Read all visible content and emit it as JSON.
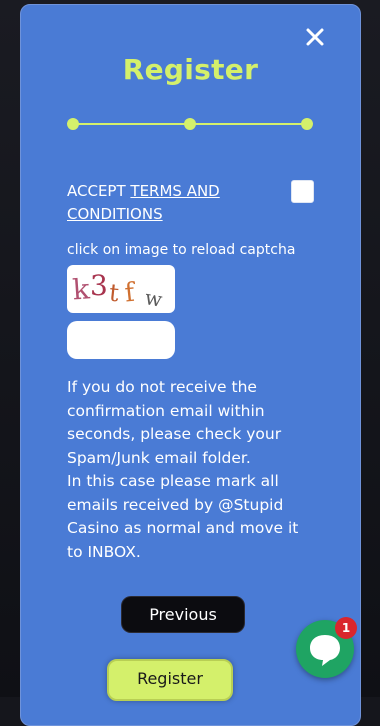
{
  "modal": {
    "title": "Register",
    "close_label": "close",
    "stepper": {
      "steps": 3,
      "current": 1
    },
    "terms": {
      "accept_text": "ACCEPT ",
      "link_text_1": "TERMS AND",
      "link_text_2": "CONDITIONS",
      "checked": false
    },
    "captcha": {
      "hint": "click on image to reload captcha",
      "image_text": "k3tfw",
      "input_value": "",
      "input_placeholder": ""
    },
    "notice_lines": [
      "If you do not receive the",
      "confirmation email within",
      "seconds, please check your",
      "Spam/Junk email folder.",
      "In this case please mark all",
      "emails received by @Stupid",
      "Casino as normal and move it",
      "to INBOX."
    ],
    "buttons": {
      "previous": "Previous",
      "register": "Register"
    }
  },
  "chat": {
    "icon": "chat-bubble-icon",
    "badge_count": "1"
  },
  "colors": {
    "modal_bg": "#4a7bd5",
    "accent": "#d4f06b",
    "chat_green": "#1fa463",
    "badge_red": "#d9262d"
  }
}
